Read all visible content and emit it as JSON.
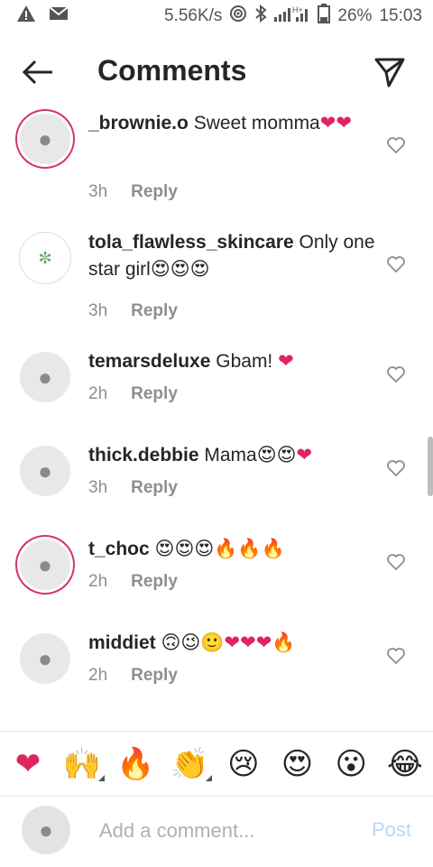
{
  "status": {
    "net_speed": "5.56K/s",
    "battery": "26%",
    "time": "15:03",
    "net_type": "H+"
  },
  "header": {
    "title": "Comments"
  },
  "comments": [
    {
      "username": "_brownie.o",
      "text": "Sweet momma",
      "emojis": [
        "❤",
        "❤"
      ],
      "time": "3h",
      "reply": "Reply"
    },
    {
      "username": "tola_flawless_skincare",
      "text": "Only one star girl",
      "emojis": [
        "😍",
        "😍",
        "😍"
      ],
      "time": "3h",
      "reply": "Reply"
    },
    {
      "username": "temarsdeluxe",
      "text": "Gbam!",
      "emojis": [
        "❤"
      ],
      "time": "2h",
      "reply": "Reply"
    },
    {
      "username": "thick.debbie",
      "text": "Mama",
      "emojis": [
        "😍",
        "😍",
        "❤"
      ],
      "time": "3h",
      "reply": "Reply"
    },
    {
      "username": "t_choc",
      "text": "",
      "emojis": [
        "😍",
        "😍",
        "😍",
        "🔥",
        "🔥",
        "🔥"
      ],
      "time": "2h",
      "reply": "Reply"
    },
    {
      "username": "middiet",
      "text": "",
      "emojis": [
        "🙃",
        "😉",
        "🙂",
        "❤",
        "❤",
        "❤",
        "🔥"
      ],
      "time": "2h",
      "reply": "Reply"
    }
  ],
  "emoji_bar": [
    "❤",
    "🙌",
    "🔥",
    "👏",
    "😢",
    "😍",
    "😮",
    "😂"
  ],
  "input": {
    "placeholder": "Add a comment...",
    "post_label": "Post"
  },
  "colors": {
    "heart": "#e0245e",
    "post_disabled": "#b8daf7",
    "ring": "#d6336c"
  }
}
